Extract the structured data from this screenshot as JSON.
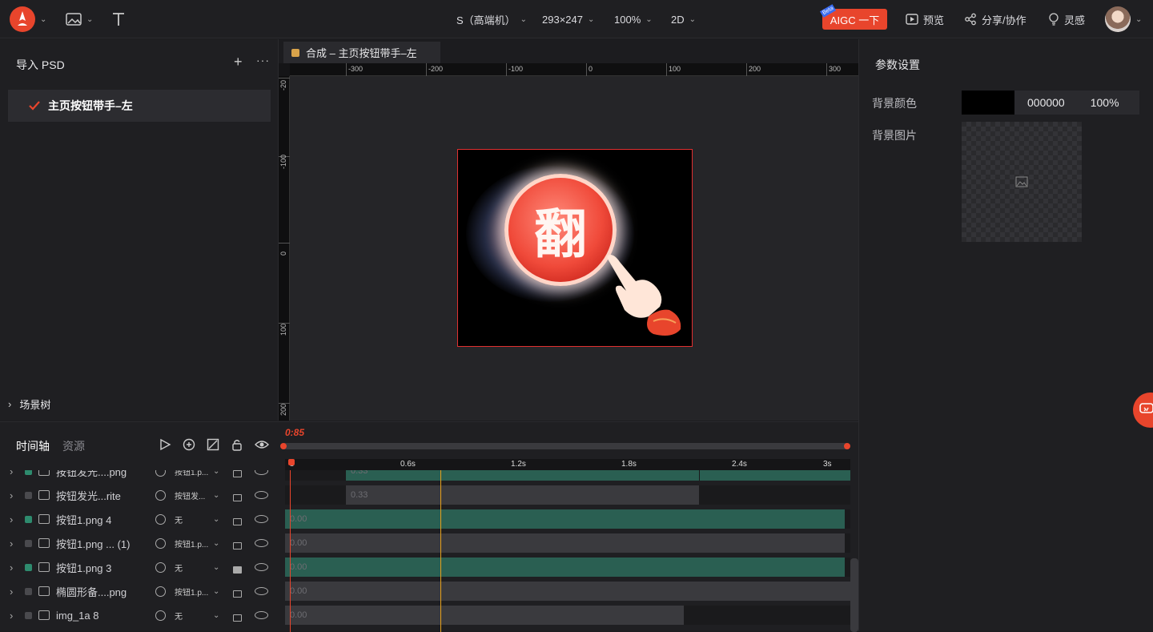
{
  "topbar": {
    "resolution": "S（高端机）",
    "size": "293×247",
    "zoom": "100%",
    "mode": "2D",
    "aigc_label": "AIGC 一下",
    "aigc_badge": "Beta",
    "preview_label": "预览",
    "share_label": "分享/协作",
    "inspire_label": "灵感"
  },
  "left": {
    "title": "导入 PSD",
    "file_name": "主页按钮带手–左",
    "scene_tree": "场景树"
  },
  "canvas": {
    "tab_title": "合成 – 主页按钮带手–左",
    "ruler_h": [
      "-300",
      "-200",
      "-100",
      "0",
      "100",
      "200",
      "300"
    ],
    "ruler_v": [
      "-20",
      "-100",
      "0",
      "100",
      "200"
    ],
    "button_text": "翻"
  },
  "right": {
    "title": "参数设置",
    "bg_color_label": "背景颜色",
    "bg_color_hex": "000000",
    "bg_color_opacity": "100%",
    "bg_image_label": "背景图片"
  },
  "timeline": {
    "tab_timeline": "时间轴",
    "tab_assets": "资源",
    "current_time": "0:85",
    "ticks": [
      "s",
      "0.6s",
      "1.2s",
      "1.8s",
      "2.4s",
      "3s"
    ],
    "layers": [
      {
        "name": "按钮发光....png",
        "blend": "按钮1.p...",
        "color": "#2e8b6e"
      },
      {
        "name": "按钮发光...rite",
        "blend": "按钮发...",
        "color": "#4a4a4e"
      },
      {
        "name": "按钮1.png 4",
        "blend": "无",
        "color": "#2e8b6e"
      },
      {
        "name": "按钮1.png ... (1)",
        "blend": "按钮1.p...",
        "color": "#4a4a4e"
      },
      {
        "name": "按钮1.png 3",
        "blend": "无",
        "color": "#2e8b6e"
      },
      {
        "name": "椭圆形备....png",
        "blend": "按钮1.p...",
        "color": "#4a4a4e"
      },
      {
        "name": "img_1a 8",
        "blend": "无",
        "color": "#4a4a4e"
      }
    ],
    "tracks": [
      "0.33",
      "0.33",
      "0.00",
      "0.00",
      "0.00",
      "0.00",
      "0.00"
    ]
  },
  "colors": {
    "accent": "#e8452c",
    "track_green": "#2a5f52",
    "track_gray": "#3a3a3e",
    "playhead": "#e8a21c"
  }
}
